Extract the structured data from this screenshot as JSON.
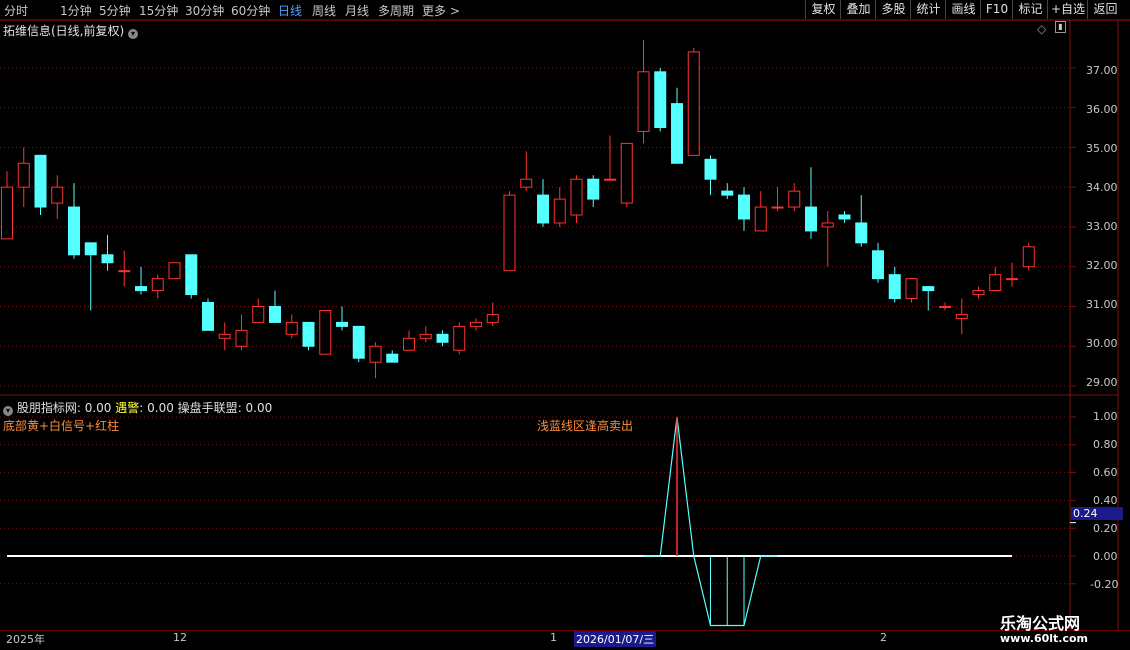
{
  "periods": [
    "分时",
    "1分钟",
    "5分钟",
    "15分钟",
    "30分钟",
    "60分钟",
    "日线",
    "周线",
    "月线",
    "多周期",
    "更多 >"
  ],
  "active_period": "日线",
  "toolbar": [
    "复权",
    "叠加",
    "多股",
    "统计",
    "画线",
    "F10",
    "标记",
    "+自选",
    "返回"
  ],
  "chart_title": "拓维信息(日线,前复权)",
  "price_axis": [
    "37.00",
    "36.00",
    "35.00",
    "34.00",
    "33.00",
    "32.00",
    "31.00",
    "30.00",
    "29.00"
  ],
  "indicator": {
    "name": "股朋指标网",
    "name_value": ": 0.00",
    "alert_label": "遇警",
    "alert_value": ": 0.00",
    "union_label": "操盘手联盟",
    "union_value": ": 0.00",
    "note_left": "底部黄+白信号+红柱",
    "note_center": "浅蓝线区逢高卖出",
    "axis": [
      "1.00",
      "0.80",
      "0.60",
      "0.40",
      "0.20",
      "0.00",
      "-0.20"
    ],
    "current_value": "0.24",
    "series": [
      0,
      0,
      0,
      0,
      0,
      0,
      0,
      0,
      0,
      0,
      0,
      0,
      0,
      0,
      0,
      0,
      0,
      0,
      0,
      0,
      0,
      0,
      0,
      0,
      0,
      0,
      0,
      0,
      0,
      0,
      0,
      0,
      0,
      0,
      0,
      0,
      0,
      0,
      0,
      0,
      1,
      0,
      -0.5,
      -0.5,
      -0.5,
      0,
      0,
      0,
      0,
      0,
      0,
      0,
      0,
      0,
      0,
      0,
      0,
      0,
      0,
      0
    ]
  },
  "dates": [
    "2025年",
    "12",
    "1",
    "2026/01/07/三",
    "2"
  ],
  "watermark": {
    "line1": "乐淘公式网",
    "line2": "www.60lt.com"
  },
  "colors": {
    "up": "#ff3232",
    "down": "#54ffff",
    "grid": "#7a1010",
    "active": "#4fa3ff"
  },
  "chart_data": {
    "type": "candlestick",
    "title": "拓维信息(日线,前复权)",
    "ylim": [
      28.8,
      37.8
    ],
    "candles": [
      [
        32.7,
        34.0,
        34.4,
        32.7
      ],
      [
        34.0,
        34.6,
        35.0,
        33.5
      ],
      [
        34.8,
        33.5,
        34.8,
        33.3
      ],
      [
        33.6,
        34.0,
        34.3,
        33.2
      ],
      [
        33.5,
        32.3,
        34.1,
        32.2
      ],
      [
        32.6,
        32.3,
        32.6,
        30.9
      ],
      [
        32.3,
        32.1,
        32.8,
        31.9
      ],
      [
        31.9,
        31.9,
        32.4,
        31.5
      ],
      [
        31.5,
        31.4,
        32.0,
        31.3
      ],
      [
        31.4,
        31.7,
        31.8,
        31.2
      ],
      [
        31.7,
        32.1,
        32.1,
        31.7
      ],
      [
        32.3,
        31.3,
        32.3,
        31.2
      ],
      [
        31.1,
        30.4,
        31.2,
        30.4
      ],
      [
        30.2,
        30.3,
        30.6,
        29.9
      ],
      [
        30.0,
        30.4,
        30.8,
        29.9
      ],
      [
        30.6,
        31.0,
        31.2,
        30.6
      ],
      [
        31.0,
        30.6,
        31.4,
        30.6
      ],
      [
        30.3,
        30.6,
        30.8,
        30.2
      ],
      [
        30.6,
        30.0,
        30.6,
        29.9
      ],
      [
        29.8,
        30.9,
        30.9,
        29.8
      ],
      [
        30.6,
        30.5,
        31.0,
        30.4
      ],
      [
        30.5,
        29.7,
        30.5,
        29.6
      ],
      [
        29.6,
        30.0,
        30.1,
        29.2
      ],
      [
        29.8,
        29.6,
        29.9,
        29.6
      ],
      [
        29.9,
        30.2,
        30.4,
        29.9
      ],
      [
        30.2,
        30.3,
        30.5,
        30.1
      ],
      [
        30.3,
        30.1,
        30.4,
        30.0
      ],
      [
        29.9,
        30.5,
        30.6,
        29.8
      ],
      [
        30.5,
        30.6,
        30.7,
        30.4
      ],
      [
        30.6,
        30.8,
        31.1,
        30.5
      ],
      [
        31.9,
        33.8,
        33.9,
        31.9
      ],
      [
        34.0,
        34.2,
        34.9,
        33.9
      ],
      [
        33.8,
        33.1,
        34.2,
        33.0
      ],
      [
        33.1,
        33.7,
        34.0,
        33.0
      ],
      [
        33.3,
        34.2,
        34.3,
        33.1
      ],
      [
        34.2,
        33.7,
        34.3,
        33.5
      ],
      [
        34.2,
        34.2,
        35.3,
        34.2
      ],
      [
        33.6,
        35.1,
        35.1,
        33.5
      ],
      [
        35.4,
        36.9,
        37.7,
        35.1
      ],
      [
        36.9,
        35.5,
        37.0,
        35.4
      ],
      [
        36.1,
        34.6,
        36.5,
        34.6
      ],
      [
        34.8,
        37.4,
        37.5,
        35.1
      ],
      [
        34.7,
        34.2,
        34.8,
        33.8
      ],
      [
        33.9,
        33.8,
        34.1,
        33.7
      ],
      [
        33.8,
        33.2,
        34.0,
        32.9
      ],
      [
        32.9,
        33.5,
        33.9,
        32.9
      ],
      [
        33.5,
        33.5,
        34.0,
        33.4
      ],
      [
        33.5,
        33.9,
        34.1,
        33.4
      ],
      [
        33.5,
        32.9,
        34.5,
        32.7
      ],
      [
        33.0,
        33.1,
        33.4,
        32.0
      ],
      [
        33.3,
        33.2,
        33.4,
        33.1
      ],
      [
        33.1,
        32.6,
        33.8,
        32.5
      ],
      [
        32.4,
        31.7,
        32.6,
        31.6
      ],
      [
        31.8,
        31.2,
        32.0,
        31.1
      ],
      [
        31.2,
        31.7,
        31.7,
        31.1
      ],
      [
        31.5,
        31.4,
        31.5,
        30.9
      ],
      [
        31.0,
        31.0,
        31.1,
        30.9
      ],
      [
        30.7,
        30.8,
        31.2,
        30.3
      ],
      [
        31.3,
        31.4,
        31.5,
        31.2
      ],
      [
        31.4,
        31.8,
        32.0,
        31.4
      ],
      [
        31.7,
        31.7,
        32.1,
        31.5
      ],
      [
        32.0,
        32.5,
        32.6,
        31.9
      ]
    ]
  }
}
